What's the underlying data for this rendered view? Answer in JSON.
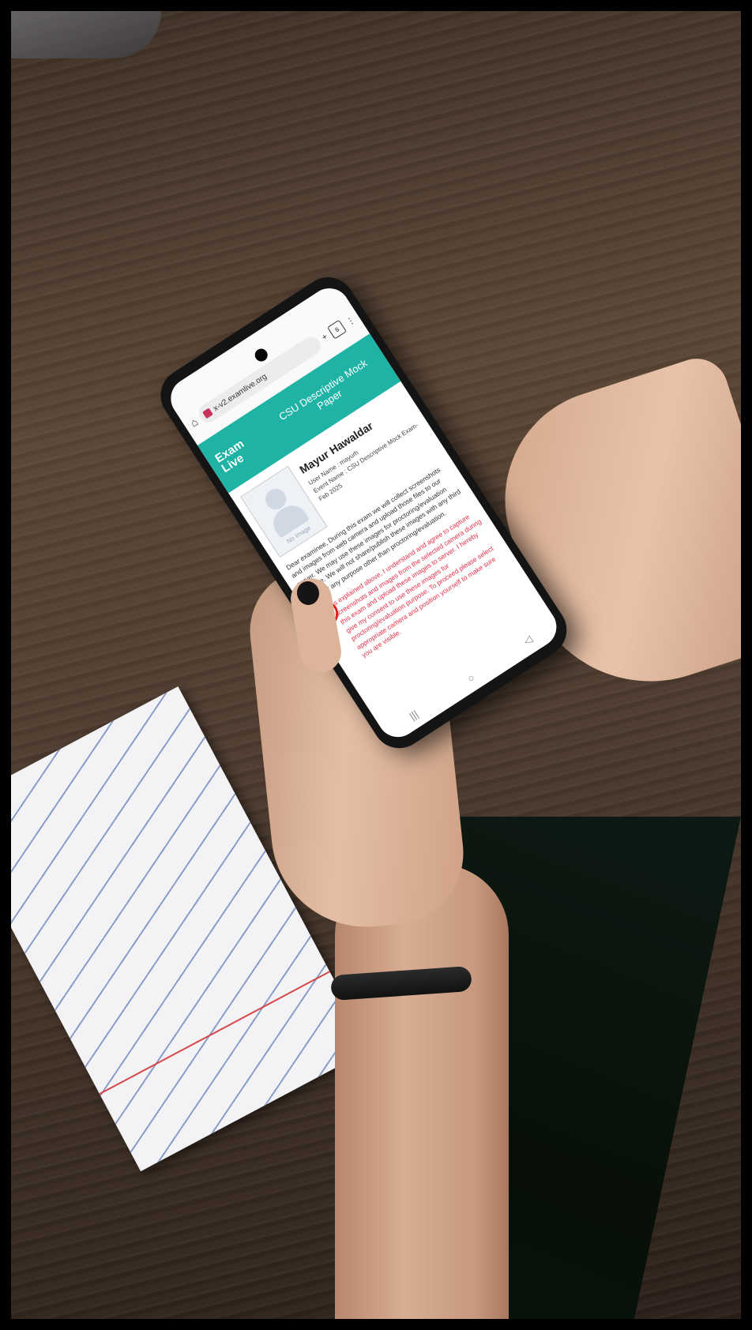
{
  "browser": {
    "url": "x-v2.examlive.org",
    "home_icon": "home-icon",
    "new_tab_label": "+",
    "tab_count": "8",
    "menu_label": "⋮"
  },
  "site": {
    "logo": "Exam Live",
    "logo_tagline": "",
    "exam_title": "CSU Descriptive Mock Paper",
    "accent_color": "#1fb3a6"
  },
  "candidate": {
    "name": "Mayur Hawaldar",
    "user_name": "User Name : mayurh",
    "event_name": "Event Name : CSU Descriptive Mock Exam- Feb 2025",
    "photo_placeholder": "No Image"
  },
  "notice": "Dear examinee, During this exam we will collect screenshots and images from web camera and upload those files to our server. We may use these images for proctoring/evaluation purpose. We will not share/publish these images with any third party for any purpose other than proctoring/evaluation.",
  "consent": {
    "checked": false,
    "text": "As explained above, I understand and agree to capture screenshots and images from the selected camera during this exam and upload these images to server. I hereby give my consent to use these images for proctoring/evaluation purpose. To proceed please select appropriate camera and position yourself to make sure you are visible.",
    "highlight_color": "#e0201c"
  },
  "android_nav": {
    "recents": "|||",
    "home": "○",
    "back": "◁"
  }
}
